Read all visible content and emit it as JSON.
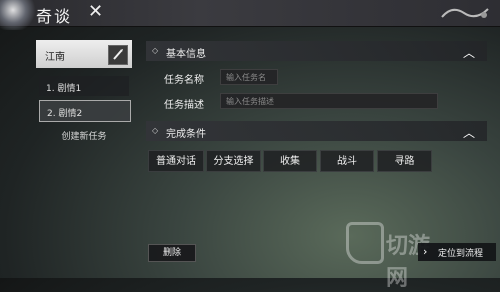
{
  "window": {
    "title": "奇谈",
    "close_icon": "close-icon"
  },
  "sidebar": {
    "region": "江南",
    "items": [
      {
        "label": "1. 剧情1"
      },
      {
        "label": "2. 剧情2"
      }
    ],
    "create_label": "创建新任务"
  },
  "basic_info": {
    "header": "基本信息",
    "name_label": "任务名称",
    "name_placeholder": "输入任务名",
    "desc_label": "任务描述",
    "desc_placeholder": "输入任务描述"
  },
  "conditions": {
    "header": "完成条件",
    "buttons": [
      "普通对话",
      "分支选择",
      "收集",
      "战斗",
      "寻路"
    ]
  },
  "footer": {
    "delete_label": "删除",
    "locate_label": "定位到流程"
  },
  "watermark": {
    "text": "切游网"
  }
}
